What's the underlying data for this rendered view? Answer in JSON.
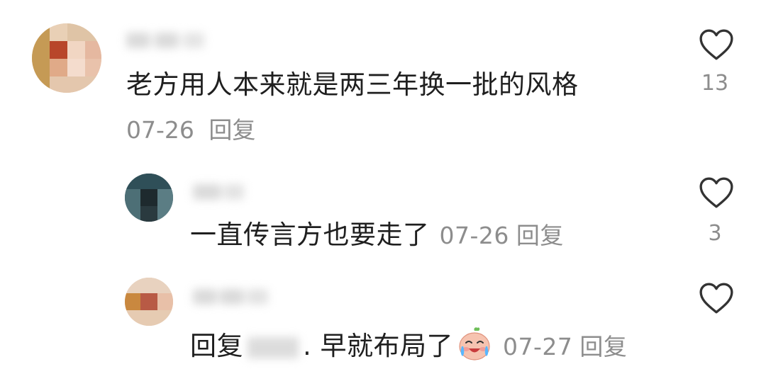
{
  "comments": [
    {
      "text": "老方用人本来就是两三年换一批的风格",
      "date": "07-26",
      "reply_label": "回复",
      "like_icon": "heart-outline-icon",
      "like_count": "13"
    }
  ],
  "replies": [
    {
      "text": "一直传言方也要走了",
      "date": "07-26",
      "reply_label": "回复",
      "like_icon": "heart-outline-icon",
      "like_count": "3"
    },
    {
      "prefix": "回复",
      "text": ". 早就布局了",
      "emoji": "crying-laughing-peach-emoji",
      "date": "07-27",
      "reply_label": "回复",
      "like_icon": "heart-outline-icon",
      "like_count": ""
    }
  ],
  "colors": {
    "text": "#1f1f1f",
    "meta": "#8d8d8d",
    "heart_stroke": "#333333",
    "background": "#ffffff"
  }
}
